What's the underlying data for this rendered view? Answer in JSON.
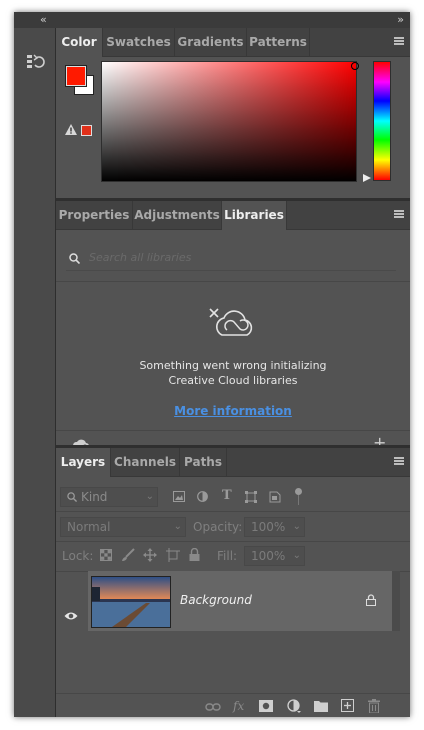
{
  "colors": {
    "panel_bg": "#535353",
    "tab_bar_bg": "#424242",
    "foreground_swatch": "#ff1a00",
    "background_swatch": "#ffffff",
    "link_blue": "#4a90e2",
    "layer_selected_bg": "#666666"
  },
  "icons": {
    "collapse_left": "«",
    "collapse_right": "»",
    "search": "magnifier-icon",
    "cloud_error": "cloud-cross-icon",
    "add": "+"
  },
  "color_panel": {
    "tabs": [
      "Color",
      "Swatches",
      "Gradients",
      "Patterns"
    ],
    "active_tab": "Color"
  },
  "properties_panel": {
    "tabs": [
      "Properties",
      "Adjustments",
      "Libraries"
    ],
    "active_tab": "Libraries",
    "search_placeholder": "Search all libraries",
    "error_line1": "Something went wrong initializing",
    "error_line2": "Creative Cloud libraries",
    "more_info_link": "More information"
  },
  "layers_panel": {
    "tabs": [
      "Layers",
      "Channels",
      "Paths"
    ],
    "active_tab": "Layers",
    "filter_kind": "Kind",
    "blend_mode": "Normal",
    "opacity_label": "Opacity:",
    "opacity_value": "100%",
    "lock_label": "Lock:",
    "fill_label": "Fill:",
    "fill_value": "100%",
    "layers": [
      {
        "name": "Background",
        "visible": true,
        "locked": true
      }
    ],
    "footer_fx": "fx"
  }
}
